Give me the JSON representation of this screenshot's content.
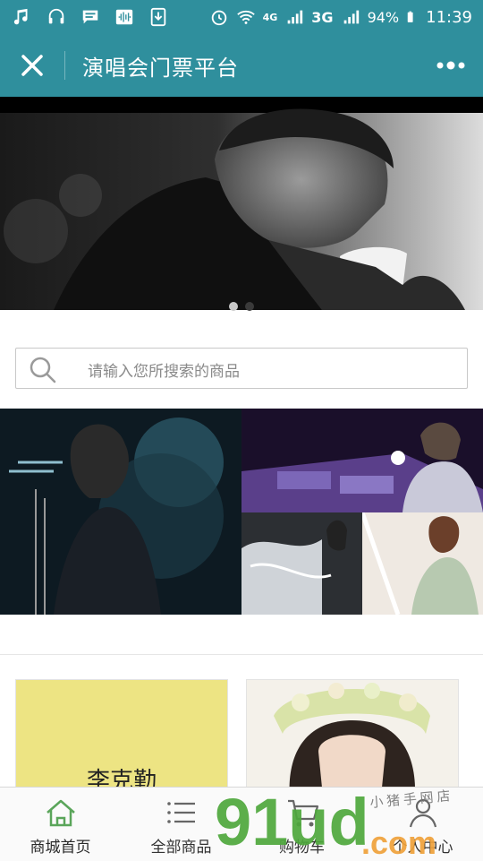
{
  "status_bar": {
    "battery": "94%",
    "network": "3G",
    "network2": "4G",
    "time": "11:39",
    "icons": [
      "music-icon",
      "headset-icon",
      "message-icon",
      "audio-icon",
      "download-icon",
      "alarm-icon",
      "wifi-icon",
      "signal-icon",
      "battery-icon"
    ]
  },
  "header": {
    "title": "演唱会门票平台",
    "close_icon": "close-icon",
    "more_icon": "more-dots-icon"
  },
  "banner": {
    "slide_count": 2,
    "active_slide": 2
  },
  "search": {
    "placeholder": "请输入您所搜索的商品"
  },
  "products": [
    {
      "title": "李克勤"
    },
    {
      "title": ""
    }
  ],
  "bottom_nav": [
    {
      "label": "商城首页",
      "icon": "home-icon",
      "active": true
    },
    {
      "label": "全部商品",
      "icon": "list-icon",
      "active": false
    },
    {
      "label": "购物车",
      "icon": "cart-icon",
      "active": false
    },
    {
      "label": "个人中心",
      "icon": "user-icon",
      "active": false
    }
  ],
  "watermark": {
    "text": "91ud.com",
    "tagline": "小猪手网店"
  },
  "colors": {
    "header_bg": "#2f8f9d",
    "accent_green": "#5aa55a",
    "card_yellow": "#ede483"
  }
}
